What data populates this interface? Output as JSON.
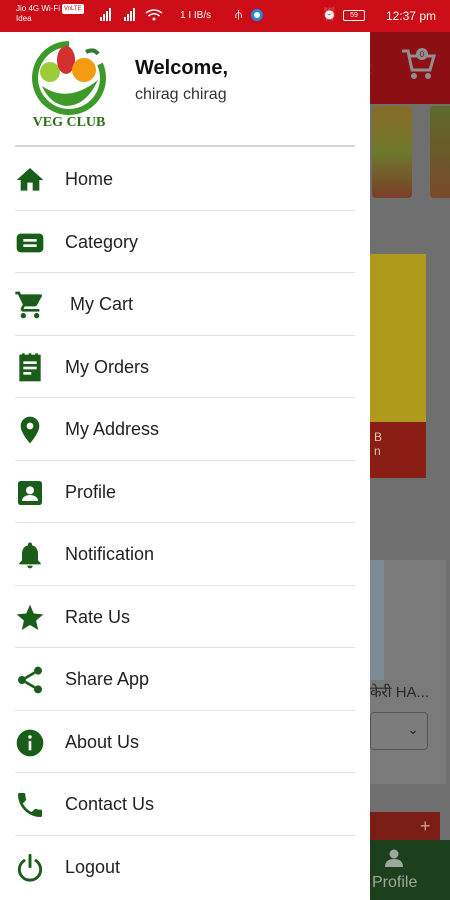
{
  "status_bar": {
    "carrier_line1": "Jio 4G Wi-Fi",
    "carrier_badge": "VoLTE",
    "carrier_line2": "Idea",
    "net_speed": "1 I IB/s",
    "battery": "59",
    "time": "12:37 pm"
  },
  "drawer": {
    "logo_text": "VEG CLUB",
    "welcome": "Welcome,",
    "user_name": "chirag chirag",
    "menu": [
      {
        "label": "Home",
        "icon": "home-icon"
      },
      {
        "label": "Category",
        "icon": "category-icon"
      },
      {
        "label": "My Cart",
        "icon": "cart-icon"
      },
      {
        "label": "My Orders",
        "icon": "orders-icon"
      },
      {
        "label": "My Address",
        "icon": "location-pin-icon"
      },
      {
        "label": "Profile",
        "icon": "profile-card-icon"
      },
      {
        "label": "Notification",
        "icon": "bell-icon"
      },
      {
        "label": "Rate Us",
        "icon": "star-icon"
      },
      {
        "label": "Share App",
        "icon": "share-icon"
      },
      {
        "label": "About Us",
        "icon": "info-icon"
      },
      {
        "label": "Contact Us",
        "icon": "phone-icon"
      },
      {
        "label": "Logout",
        "icon": "power-icon"
      }
    ]
  },
  "background": {
    "cart_count": "0",
    "hindi_text": "केरी HA...",
    "red_banner_text": "B\nn",
    "bottom_nav_profile": "Profile"
  },
  "colors": {
    "status_bar": "#cc0d18",
    "icon_green": "#1a5d1a",
    "drawer_bg": "#ffffff"
  }
}
